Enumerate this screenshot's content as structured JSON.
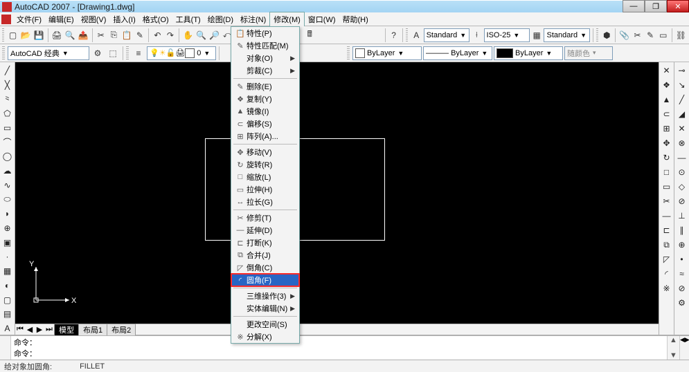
{
  "window": {
    "title": "AutoCAD 2007 - [Drawing1.dwg]"
  },
  "win_controls": {
    "min": "—",
    "max": "❐",
    "close": "✕"
  },
  "menu": {
    "items": [
      {
        "label": "文件(F)"
      },
      {
        "label": "编辑(E)"
      },
      {
        "label": "视图(V)"
      },
      {
        "label": "插入(I)"
      },
      {
        "label": "格式(O)"
      },
      {
        "label": "工具(T)"
      },
      {
        "label": "绘图(D)"
      },
      {
        "label": "标注(N)"
      },
      {
        "label": "修改(M)",
        "open": true
      },
      {
        "label": "窗口(W)"
      },
      {
        "label": "帮助(H)"
      }
    ]
  },
  "dropdown": {
    "items": [
      {
        "label": "特性(P)",
        "icon": "📋"
      },
      {
        "label": "特性匹配(M)",
        "icon": "✎"
      },
      {
        "label": "对象(O)",
        "submenu": true
      },
      {
        "label": "剪裁(C)",
        "submenu": true
      },
      {
        "sep": true
      },
      {
        "label": "删除(E)",
        "icon": "✎"
      },
      {
        "label": "复制(Y)",
        "icon": "❖"
      },
      {
        "label": "镜像(I)",
        "icon": "▲"
      },
      {
        "label": "偏移(S)",
        "icon": "⊂"
      },
      {
        "label": "阵列(A)...",
        "icon": "⊞"
      },
      {
        "sep": true
      },
      {
        "label": "移动(V)",
        "icon": "✥"
      },
      {
        "label": "旋转(R)",
        "icon": "↻"
      },
      {
        "label": "缩放(L)",
        "icon": "□"
      },
      {
        "label": "拉伸(H)",
        "icon": "▭"
      },
      {
        "label": "拉长(G)",
        "icon": "↔"
      },
      {
        "sep": true
      },
      {
        "label": "修剪(T)",
        "icon": "✂"
      },
      {
        "label": "延伸(D)",
        "icon": "—"
      },
      {
        "label": "打断(K)",
        "icon": "⊏"
      },
      {
        "label": "合并(J)",
        "icon": "⧉"
      },
      {
        "label": "倒角(C)",
        "icon": "◸"
      },
      {
        "label": "圆角(F)",
        "icon": "◜",
        "highlight": true
      },
      {
        "sep": true
      },
      {
        "label": "三维操作(3)",
        "submenu": true
      },
      {
        "label": "实体编辑(N)",
        "submenu": true
      },
      {
        "sep": true
      },
      {
        "label": "更改空间(S)"
      },
      {
        "label": "分解(X)",
        "icon": "※"
      }
    ]
  },
  "toolbar_top": {
    "standard_combo": "Standard",
    "dimstyle_combo": "ISO-25",
    "textstyle_combo": "Standard"
  },
  "toolbar_layer": {
    "workspace": "AutoCAD 经典",
    "layer_state": "💡☀️🔒🖨️■ 0",
    "layer0": "0",
    "bylayer_line": "ByLayer",
    "bylayer_lt": "ByLayer",
    "bylayer_color": "ByLayer",
    "color_combo": "随颜色"
  },
  "tabs": {
    "model": "模型",
    "layout1": "布局1",
    "layout2": "布局2"
  },
  "command": {
    "line1": "命令：",
    "line2": "命令："
  },
  "status": {
    "hint": "给对象加圆角:",
    "cmd": "FILLET"
  }
}
